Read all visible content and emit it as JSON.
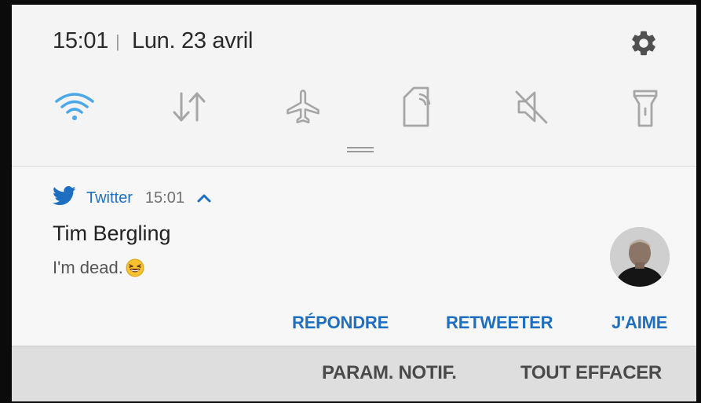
{
  "status": {
    "time": "15:01",
    "separator": "|",
    "date": "Lun. 23 avril"
  },
  "icons": {
    "settings": "gear-icon",
    "quick_settings": [
      "wifi-icon",
      "mobile-data-icon",
      "airplane-mode-icon",
      "screen-rotation-icon",
      "mute-icon",
      "flashlight-icon"
    ]
  },
  "quick_settings_state": {
    "wifi": "on",
    "mobile_data": "off",
    "airplane_mode": "off",
    "screen_rotation": "off",
    "sound": "muted",
    "flashlight": "off"
  },
  "notification": {
    "app_name": "Twitter",
    "time": "15:01",
    "title": "Tim Bergling",
    "body": "I'm dead.",
    "actions": [
      "RÉPONDRE",
      "RETWEETER",
      "J'AIME"
    ]
  },
  "bottom_bar": {
    "settings_label": "PARAM. NOTIF.",
    "clear_label": "TOUT EFFACER"
  },
  "colors": {
    "accent": "#1e6fc1",
    "wifi_active": "#4aa8e8",
    "panel_bg": "#f4f4f4",
    "bottom_bar_bg": "#dedede"
  }
}
